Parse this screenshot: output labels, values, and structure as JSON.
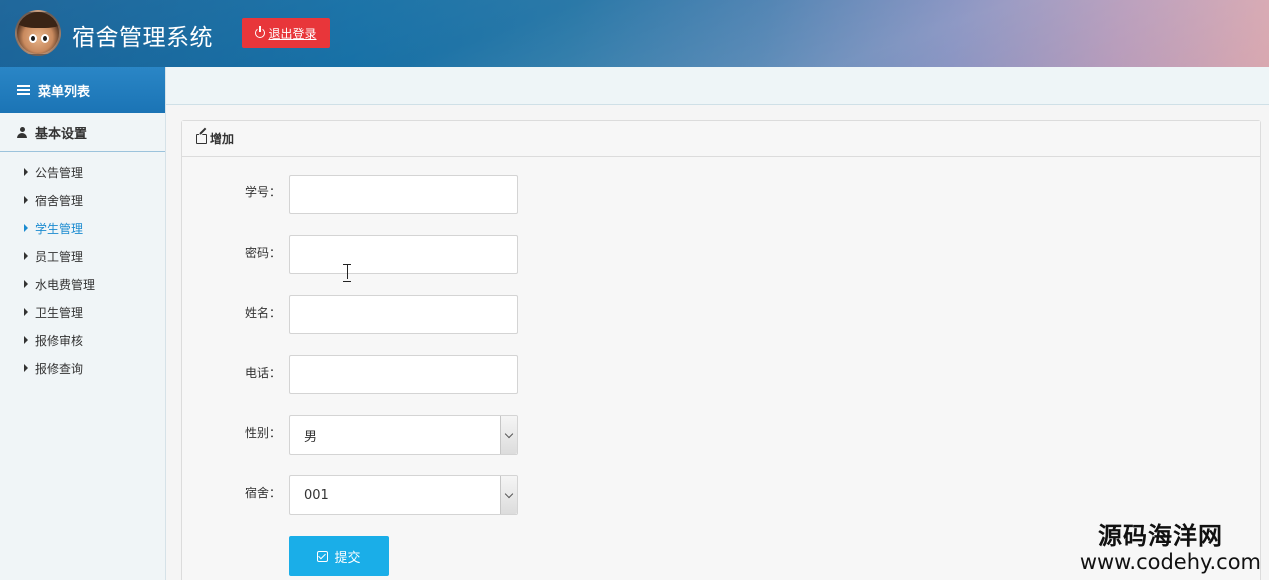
{
  "header": {
    "title": "宿舍管理系统",
    "logout_label": "退出登录",
    "logout_icon": "power-icon"
  },
  "sidebar": {
    "menu_title": "菜单列表",
    "group_title": "基本设置",
    "items": [
      {
        "label": "公告管理",
        "active": false
      },
      {
        "label": "宿舍管理",
        "active": false
      },
      {
        "label": "学生管理",
        "active": true
      },
      {
        "label": "员工管理",
        "active": false
      },
      {
        "label": "水电费管理",
        "active": false
      },
      {
        "label": "卫生管理",
        "active": false
      },
      {
        "label": "报修审核",
        "active": false
      },
      {
        "label": "报修查询",
        "active": false
      }
    ],
    "active_color": "#1b8bd0"
  },
  "panel": {
    "heading": "增加",
    "fields": {
      "student_id": {
        "label": "学号：",
        "value": ""
      },
      "password": {
        "label": "密码：",
        "value": ""
      },
      "name": {
        "label": "姓名：",
        "value": ""
      },
      "phone": {
        "label": "电话：",
        "value": ""
      },
      "gender": {
        "label": "性别：",
        "value": "男"
      },
      "dorm": {
        "label": "宿舍：",
        "value": "001"
      }
    },
    "submit_label": "提交"
  },
  "watermark": {
    "cn": "源码海洋网",
    "url": "www.codehy.com"
  },
  "colors": {
    "logout": "#e8363a",
    "submit": "#1aaee8",
    "menu_header": "#1b74b5"
  }
}
